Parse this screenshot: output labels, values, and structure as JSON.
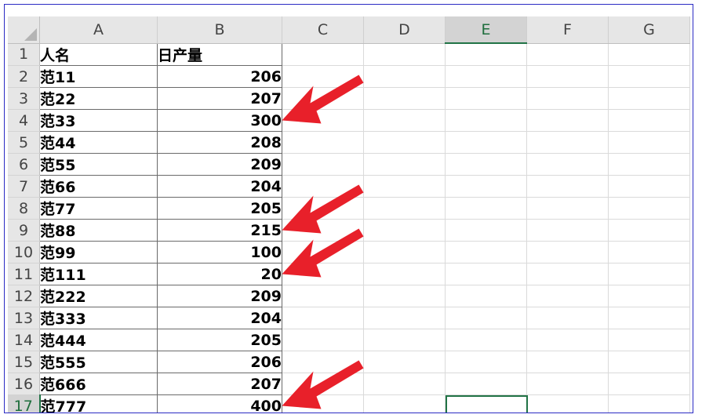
{
  "columns": [
    "A",
    "B",
    "C",
    "D",
    "E",
    "F",
    "G"
  ],
  "selected_column": "E",
  "selected_row": "17",
  "rows": [
    {
      "num": "1",
      "a": "人名",
      "b": "日产量",
      "b_is_num": false
    },
    {
      "num": "2",
      "a": "范11",
      "b": "206",
      "b_is_num": true
    },
    {
      "num": "3",
      "a": "范22",
      "b": "207",
      "b_is_num": true
    },
    {
      "num": "4",
      "a": "范33",
      "b": "300",
      "b_is_num": true
    },
    {
      "num": "5",
      "a": "范44",
      "b": "208",
      "b_is_num": true
    },
    {
      "num": "6",
      "a": "范55",
      "b": "209",
      "b_is_num": true
    },
    {
      "num": "7",
      "a": "范66",
      "b": "204",
      "b_is_num": true
    },
    {
      "num": "8",
      "a": "范77",
      "b": "205",
      "b_is_num": true
    },
    {
      "num": "9",
      "a": "范88",
      "b": "215",
      "b_is_num": true
    },
    {
      "num": "10",
      "a": "范99",
      "b": "100",
      "b_is_num": true
    },
    {
      "num": "11",
      "a": "范111",
      "b": "20",
      "b_is_num": true
    },
    {
      "num": "12",
      "a": "范222",
      "b": "209",
      "b_is_num": true
    },
    {
      "num": "13",
      "a": "范333",
      "b": "204",
      "b_is_num": true
    },
    {
      "num": "14",
      "a": "范444",
      "b": "205",
      "b_is_num": true
    },
    {
      "num": "15",
      "a": "范555",
      "b": "206",
      "b_is_num": true
    },
    {
      "num": "16",
      "a": "范666",
      "b": "207",
      "b_is_num": true
    },
    {
      "num": "17",
      "a": "范777",
      "b": "400",
      "b_is_num": true
    }
  ],
  "annotations": {
    "arrow_color": "#e8202a",
    "highlighted_rows": [
      "4",
      "9",
      "11",
      "17"
    ]
  },
  "colors": {
    "header_bg": "#e6e6e6",
    "selection_green": "#217346",
    "frame_border": "#2b2bc4"
  }
}
